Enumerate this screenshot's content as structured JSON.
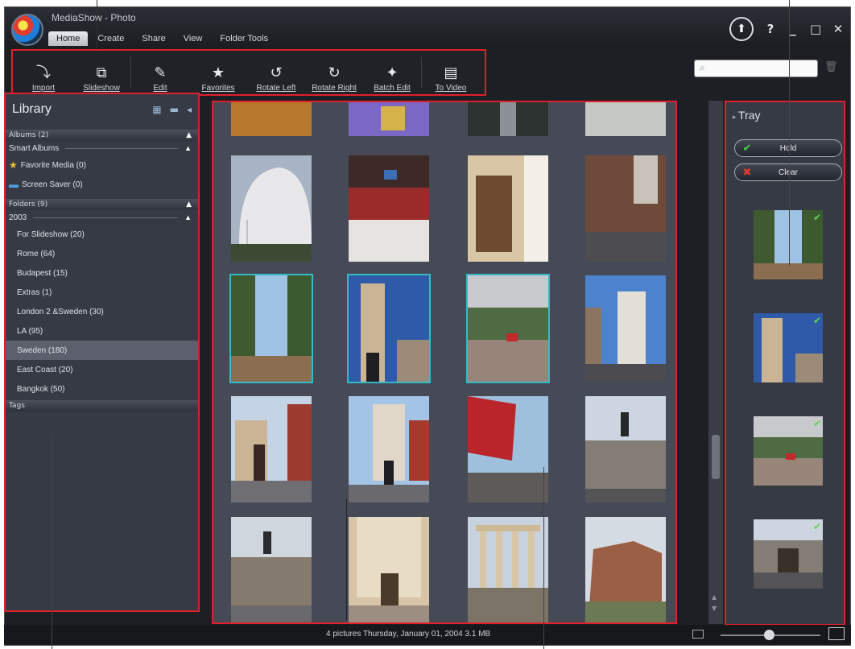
{
  "app": {
    "title": "MediaShow - Photo",
    "menu": [
      "Home",
      "Create",
      "Share",
      "View",
      "Folder Tools"
    ],
    "active_menu": "Home",
    "window_controls": [
      "?",
      "_",
      "□",
      "✕"
    ]
  },
  "toolbar": [
    {
      "label": "Import",
      "icon": "import-icon"
    },
    {
      "label": "Slideshow",
      "icon": "slideshow-icon"
    },
    {
      "label": "Edit",
      "icon": "edit-icon"
    },
    {
      "label": "Favorites",
      "icon": "star-icon"
    },
    {
      "label": "Rotate Left",
      "icon": "rotate-left-icon"
    },
    {
      "label": "Rotate Right",
      "icon": "rotate-right-icon"
    },
    {
      "label": "Batch Edit",
      "icon": "batch-edit-icon"
    },
    {
      "label": "To Video",
      "icon": "video-icon"
    }
  ],
  "search": {
    "placeholder": ""
  },
  "library": {
    "title": "Library",
    "albums": "Albums (2)",
    "smart_albums": "Smart Albums",
    "favorite_media": "Favorite Media (0)",
    "screen_saver": "Screen Saver (0)",
    "folders": "Folders (9)",
    "year": "2003",
    "folder_items": [
      "For Slideshow (20)",
      "Rome (64)",
      "Budapest (15)",
      "Extras (1)",
      "London 2 &Sweden (30)",
      "LA (95)",
      "Sweden (180)",
      "East Coast (20)",
      "Bangkok (50)"
    ],
    "selected_folder": "Sweden (180)",
    "tags": "Tags"
  },
  "tray": {
    "title": "Tray",
    "hold_label": "Hold",
    "clear_label": "Clear",
    "photo_count_checked": 4
  },
  "status": {
    "text": "4 pictures  Thursday, January 01, 2004  3.1 MB"
  },
  "colors": {
    "callout_red": "#e0202a",
    "selection_cyan": "#35b9c7",
    "panel_bg": "#363a44",
    "grid_bg": "#464a56"
  }
}
